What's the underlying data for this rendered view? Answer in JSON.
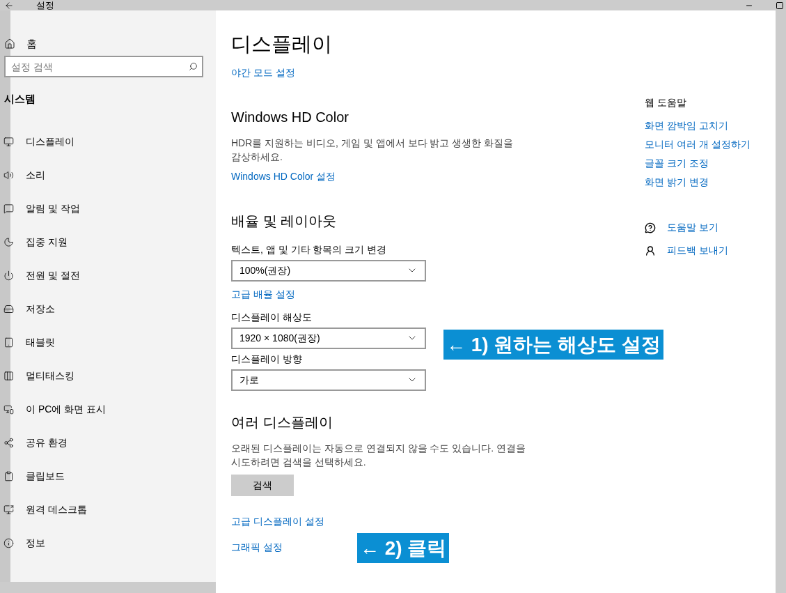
{
  "titlebar": {
    "title": "설정"
  },
  "sidebar": {
    "home": "홈",
    "search": {
      "placeholder": "설정 검색"
    },
    "section": "시스템",
    "items": [
      {
        "label": "디스플레이"
      },
      {
        "label": "소리"
      },
      {
        "label": "알림 및 작업"
      },
      {
        "label": "집중 지원"
      },
      {
        "label": "전원 및 절전"
      },
      {
        "label": "저장소"
      },
      {
        "label": "태블릿"
      },
      {
        "label": "멀티태스킹"
      },
      {
        "label": "이 PC에 화면 표시"
      },
      {
        "label": "공유 환경"
      },
      {
        "label": "클립보드"
      },
      {
        "label": "원격 데스크톱"
      },
      {
        "label": "정보"
      }
    ]
  },
  "main": {
    "title": "디스플레이",
    "blocks": [
      {
        "kind": "link",
        "text": "야간 모드 설정"
      },
      {
        "kind": "heading",
        "text": "Windows HD Color"
      },
      {
        "kind": "paragraph",
        "text": "HDR를 지원하는 비디오, 게임 및 앱에서 보다 밝고 생생한 화질을 감상하세요."
      },
      {
        "kind": "link",
        "text": "Windows HD Color 설정"
      },
      {
        "kind": "heading",
        "text": "배율 및 레이아웃"
      },
      {
        "kind": "label",
        "text": "텍스트, 앱 및 기타 항목의 크기 변경"
      },
      {
        "kind": "dropdown",
        "text": "100%(권장)"
      },
      {
        "kind": "link",
        "text": "고급 배율 설정"
      },
      {
        "kind": "label",
        "text": "디스플레이 해상도"
      },
      {
        "kind": "dropdown",
        "text": "1920 × 1080(권장)"
      },
      {
        "kind": "label",
        "text": "디스플레이 방향"
      },
      {
        "kind": "dropdown",
        "text": "가로"
      },
      {
        "kind": "heading",
        "text": "여러 디스플레이"
      },
      {
        "kind": "paragraph",
        "text": "오래된 디스플레이는 자동으로 연결되지 않을 수도 있습니다. 연결을 시도하려면 검색을 선택하세요."
      },
      {
        "kind": "button",
        "text": "검색"
      },
      {
        "kind": "link",
        "text": "고급 디스플레이 설정"
      },
      {
        "kind": "link",
        "text": "그래픽 설정"
      }
    ]
  },
  "help": {
    "title": "웹 도움말",
    "links": [
      "화면 깜박임 고치기",
      "모니터 여러 개 설정하기",
      "글꼴 크기 조정",
      "화면 밝기 변경"
    ],
    "actions": [
      {
        "text": "도움말 보기"
      },
      {
        "text": "피드백 보내기"
      }
    ]
  },
  "annotations": [
    {
      "text": "← 1) 원하는 해상도 설정"
    },
    {
      "text": "← 2) 클릭"
    }
  ]
}
